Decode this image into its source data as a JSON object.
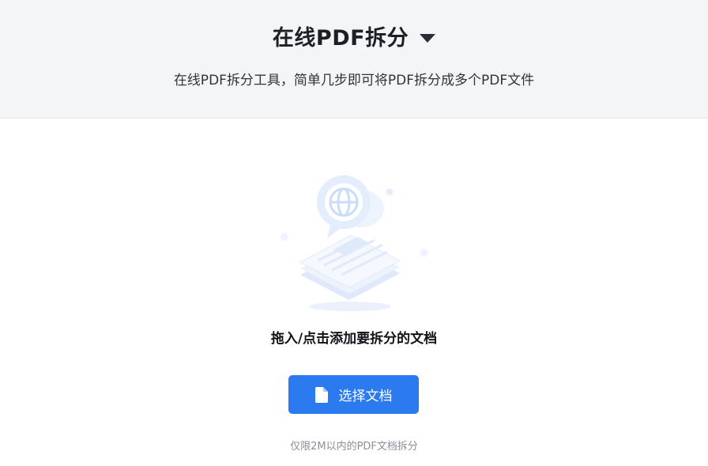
{
  "header": {
    "title": "在线PDF拆分",
    "subtitle": "在线PDF拆分工具，简单几步即可将PDF拆分成多个PDF文件"
  },
  "upload": {
    "illustration_icon": "document-globe-illustration",
    "drop_text": "拖入/点击添加要拆分的文档",
    "button_label": "选择文档",
    "button_icon": "file-icon",
    "limit_note": "仅限2M以内的PDF文档拆分"
  },
  "colors": {
    "header_bg": "#f4f5f7",
    "accent": "#2b7af0",
    "illustration": "#dbe8fb"
  }
}
